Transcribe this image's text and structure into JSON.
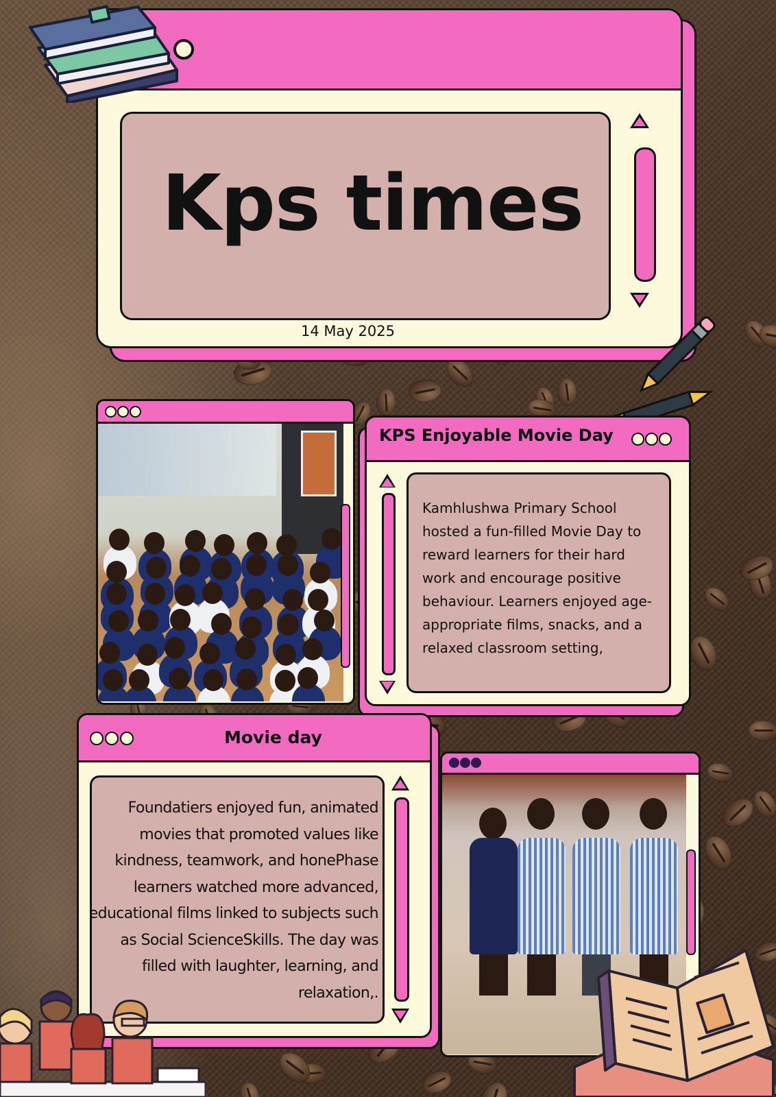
{
  "masthead": {
    "title": "Kps times",
    "date": "14 May 2025"
  },
  "article_1": {
    "heading": "KPS Enjoyable Movie Day",
    "body": "Kamhlushwa Primary School hosted a fun-filled Movie Day to reward learners for their hard work and encourage positive behaviour. Learners enjoyed age-appropriate films, snacks, and a relaxed classroom setting,"
  },
  "article_2": {
    "heading": "Movie day",
    "body": "Foundatiers enjoyed fun, animated movies that promoted values like kindness, teamwork, and honePhase learners watched more advanced, educational films linked to subjects such as Social ScienceSkills. The day was filled with laughter, learning, and relaxation,."
  },
  "photos": {
    "photo_1": "learners-watching-movie",
    "photo_2": "four-learners-with-snacks"
  },
  "colors": {
    "accent": "#f26bc0",
    "window": "#fdf9dc",
    "panel": "#d4b0ac",
    "outline": "#111111"
  },
  "icons": [
    "books-stack-icon",
    "pencil-icon",
    "pencil-icon",
    "open-book-icon",
    "students-illustration"
  ]
}
